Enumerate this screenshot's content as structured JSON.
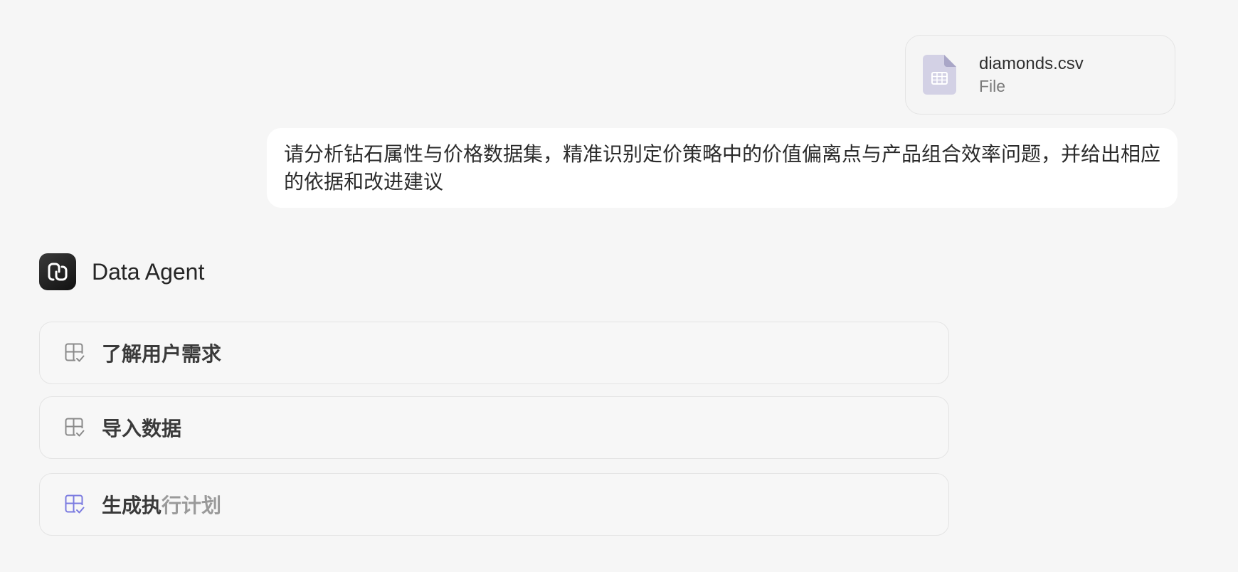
{
  "attachment": {
    "name": "diamonds.csv",
    "type": "File",
    "icon": "spreadsheet-file-icon",
    "icon_color": "#cfcde2"
  },
  "user_message": {
    "text": "请分析钻石属性与价格数据集，精准识别定价策略中的价值偏离点与产品组合效率问题，并给出相应的依据和改进建议"
  },
  "agent": {
    "name": "Data Agent",
    "avatar_icon": "data-agent-logo-icon"
  },
  "steps": [
    {
      "label": "了解用户需求",
      "status": "done",
      "icon": "layout-check-icon",
      "icon_color": "#8a8a8a"
    },
    {
      "label": "导入数据",
      "status": "done",
      "icon": "layout-check-icon",
      "icon_color": "#8a8a8a"
    },
    {
      "label_strong": "生成执",
      "label_dim": "行计划",
      "status": "in-progress",
      "icon": "layout-check-icon",
      "icon_color": "#7b7be0"
    }
  ]
}
